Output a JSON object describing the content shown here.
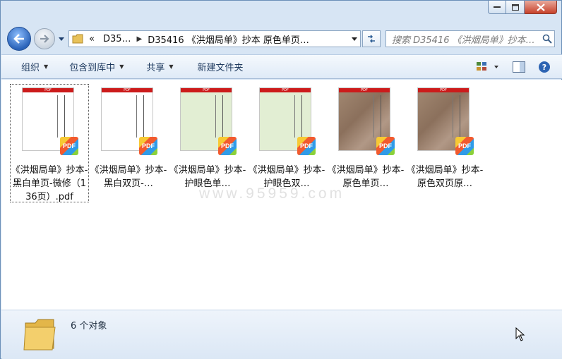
{
  "window": {
    "buttons": {
      "minimize": "minimize",
      "maximize": "maximize",
      "close": "close"
    }
  },
  "address": {
    "overflow": "«",
    "segments": [
      "D35…",
      "D35416 《洪烟局单》抄本 原色单页…"
    ]
  },
  "search": {
    "placeholder": "搜索 D35416 《洪烟局单》抄本…"
  },
  "toolbar": {
    "organize": "组织",
    "include_library": "包含到库中",
    "share": "共享",
    "new_folder": "新建文件夹"
  },
  "files": [
    {
      "label": "《洪烟局单》抄本-黑白单页-微修（136页）.pdf",
      "style": "bw",
      "selected": true
    },
    {
      "label": "《洪烟局单》抄本-黑白双页-…",
      "style": "bw",
      "selected": false
    },
    {
      "label": "《洪烟局单》抄本-护眼色单…",
      "style": "green",
      "selected": false
    },
    {
      "label": "《洪烟局单》抄本-护眼色双…",
      "style": "green",
      "selected": false
    },
    {
      "label": "《洪烟局单》抄本-原色单页…",
      "style": "orig",
      "selected": false
    },
    {
      "label": "《洪烟局单》抄本-原色双页原…",
      "style": "orig",
      "selected": false
    }
  ],
  "thumb_band_text": "PDF",
  "badge_text": "PDF",
  "watermark": "www.95959.com",
  "details": {
    "count": "6 个对象"
  }
}
